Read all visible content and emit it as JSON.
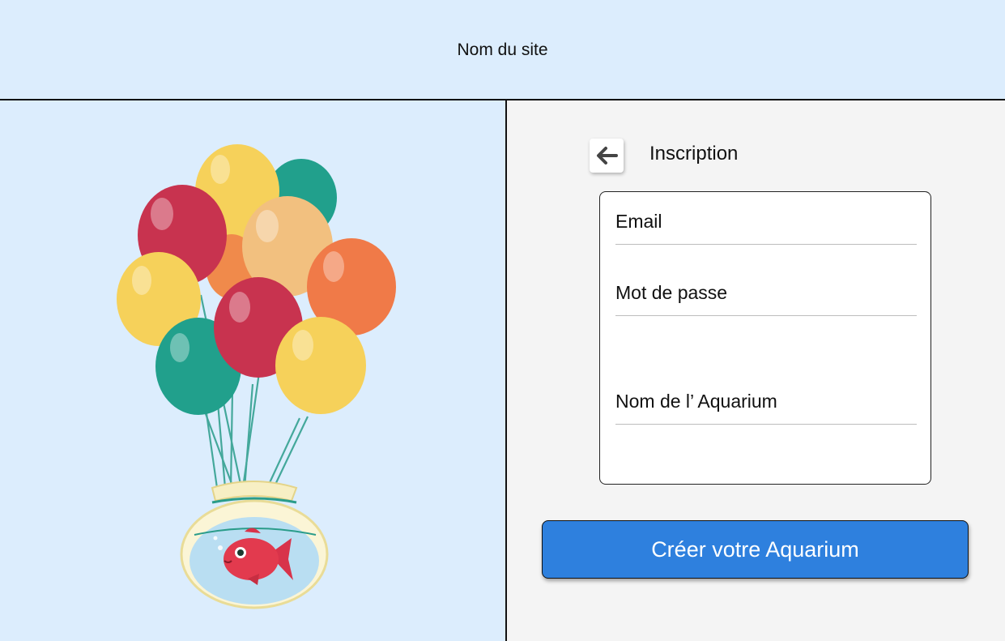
{
  "header": {
    "site_name": "Nom du site"
  },
  "illustration": {
    "description_icon": "balloons-fishbowl-illustration"
  },
  "form": {
    "back_icon": "arrow-left-icon",
    "title": "Inscription",
    "fields": [
      {
        "label": "Email"
      },
      {
        "label": "Mot de passe"
      },
      {
        "label": "Nom de l’ Aquarium"
      }
    ],
    "submit_label": "Créer votre Aquarium"
  },
  "colors": {
    "header_bg": "#dcedfd",
    "panel_bg": "#f4f4f4",
    "button_bg": "#2e80de"
  }
}
